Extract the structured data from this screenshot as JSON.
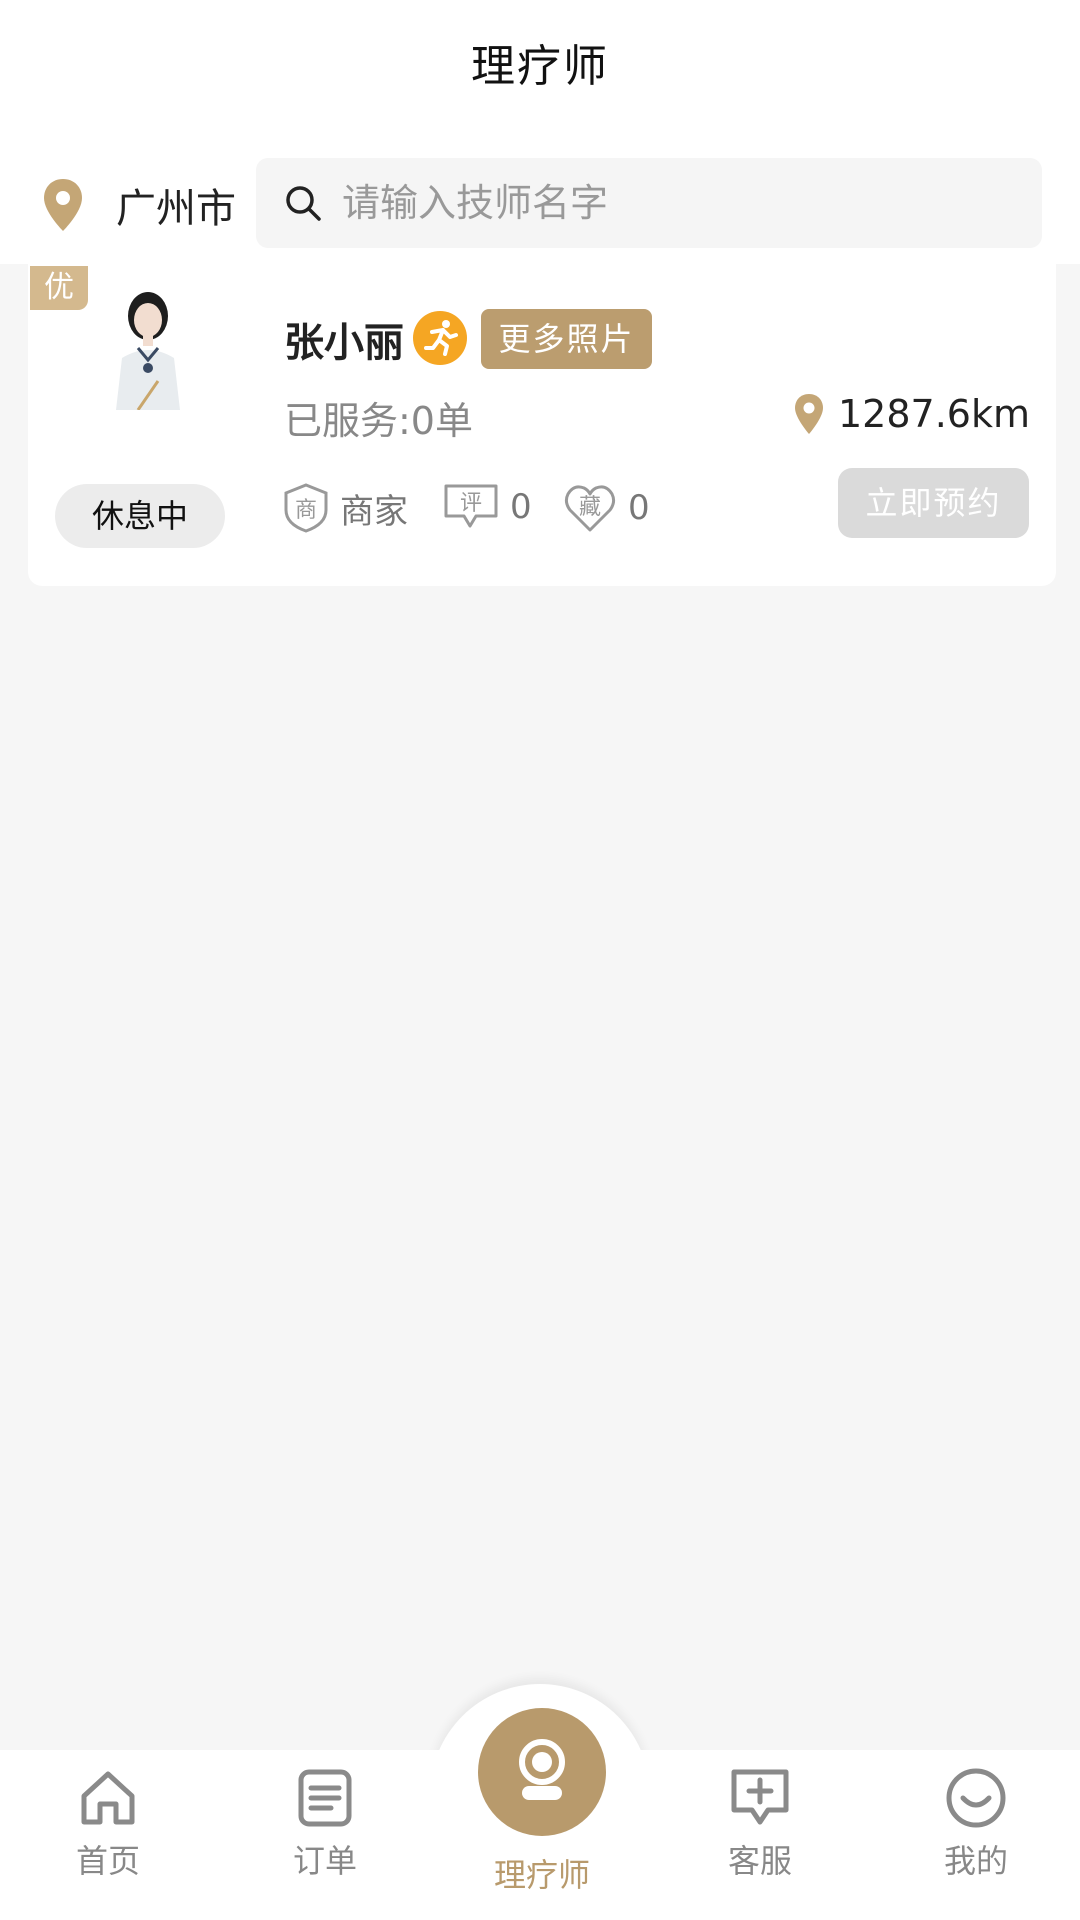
{
  "header": {
    "title": "理疗师",
    "city": "广州市",
    "search_placeholder": "请输入技师名字"
  },
  "therapist_card": {
    "badge": "优",
    "name": "张小丽",
    "more_photos_label": "更多照片",
    "served": "已服务:0单",
    "distance": "1287.6km",
    "status": "休息中",
    "merchant_label": "商家",
    "merchant_icon_text": "商",
    "review_icon_text": "评",
    "review_count": "0",
    "favorite_icon_text": "藏",
    "favorite_count": "0",
    "book_label": "立即预约"
  },
  "tabbar": {
    "items": [
      {
        "label": "首页",
        "icon": "home-icon"
      },
      {
        "label": "订单",
        "icon": "order-icon"
      },
      {
        "label": "理疗师",
        "icon": "therapist-icon",
        "active": true
      },
      {
        "label": "客服",
        "icon": "customer-service-icon"
      },
      {
        "label": "我的",
        "icon": "profile-icon"
      }
    ]
  },
  "colors": {
    "accent": "#b89a6c",
    "run_badge": "#f5a623",
    "background": "#f6f6f6"
  }
}
